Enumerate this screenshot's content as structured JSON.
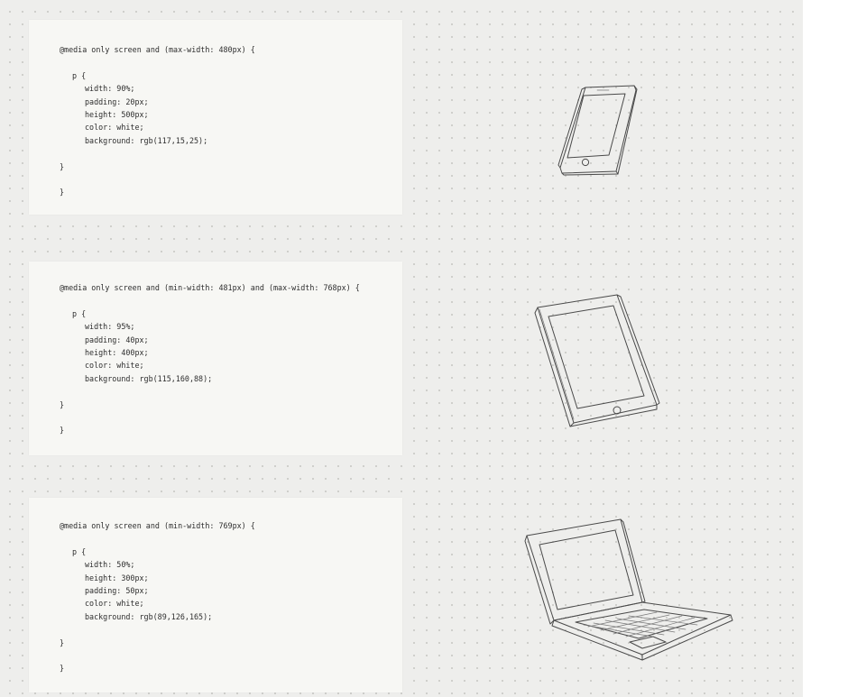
{
  "cards": [
    {
      "device": "phone",
      "media_query": "@media only screen and (max-width: 480px) {",
      "selector": "p {",
      "declarations": [
        "width: 90%;",
        "padding: 20px;",
        "height: 500px;",
        "color: white;",
        "background: rgb(117,15,25);"
      ],
      "close_inner": "}",
      "close_outer": "}"
    },
    {
      "device": "tablet",
      "media_query": "@media only screen and (min-width: 481px) and (max-width: 768px) {",
      "selector": "p {",
      "declarations": [
        "width: 95%;",
        "padding: 40px;",
        "height: 400px;",
        "color: white;",
        "background: rgb(115,160,88);"
      ],
      "close_inner": "}",
      "close_outer": "}"
    },
    {
      "device": "laptop",
      "media_query": "@media only screen and (min-width: 769px) {",
      "selector": "p {",
      "declarations": [
        "width: 50%;",
        "height: 300px;",
        "padding: 50px;",
        "color: white;",
        "background: rgb(89,126,165);"
      ],
      "close_inner": "}",
      "close_outer": "}"
    }
  ],
  "icons": [
    "phone-sketch-icon",
    "tablet-sketch-icon",
    "laptop-sketch-icon"
  ],
  "colors": {
    "board_background": "#eeeeec",
    "card_background": "#f7f7f4",
    "code_text": "#2e2e2e",
    "sketch_stroke": "#4a4a4a"
  }
}
